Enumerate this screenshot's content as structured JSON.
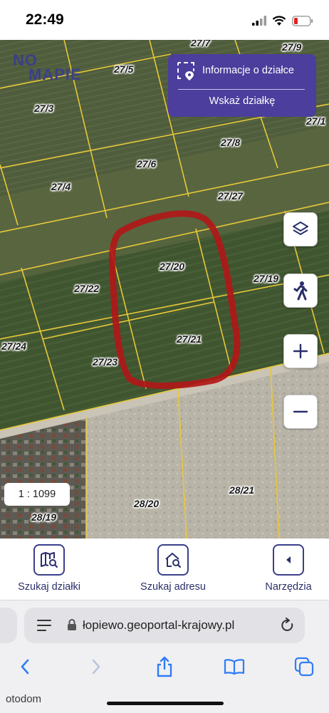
{
  "status_bar": {
    "time": "22:49"
  },
  "map": {
    "logo": {
      "line1": "NO",
      "line2": "MAPIE"
    },
    "info_panel": {
      "title": "Informacje o działce",
      "link": "Wskaż działkę"
    },
    "parcels": [
      "27/7",
      "27/9",
      "27/5",
      "27/3",
      "27/1",
      "27/8",
      "27/6",
      "27/4",
      "27/27",
      "27/20",
      "27/19",
      "27/22",
      "27/21",
      "27/24",
      "27/23",
      "28/21",
      "28/20",
      "28/19"
    ],
    "controls": {
      "layers": "layers-icon",
      "streetview": "pedestrian-icon",
      "zoom_in": "plus-icon",
      "zoom_out": "minus-icon"
    },
    "scale": "1 : 1099"
  },
  "toolbar": {
    "search_parcel": "Szukaj działki",
    "search_address": "Szukaj adresu",
    "tools": "Narzędzia"
  },
  "browser": {
    "url": "łopiewo.geoportal-krajowy.pl"
  },
  "brand": "otodom",
  "colors": {
    "accent": "#4b3e9c",
    "dark_blue": "#3b3f8a",
    "boundary": "#e8c83a",
    "marker": "#b01818"
  }
}
